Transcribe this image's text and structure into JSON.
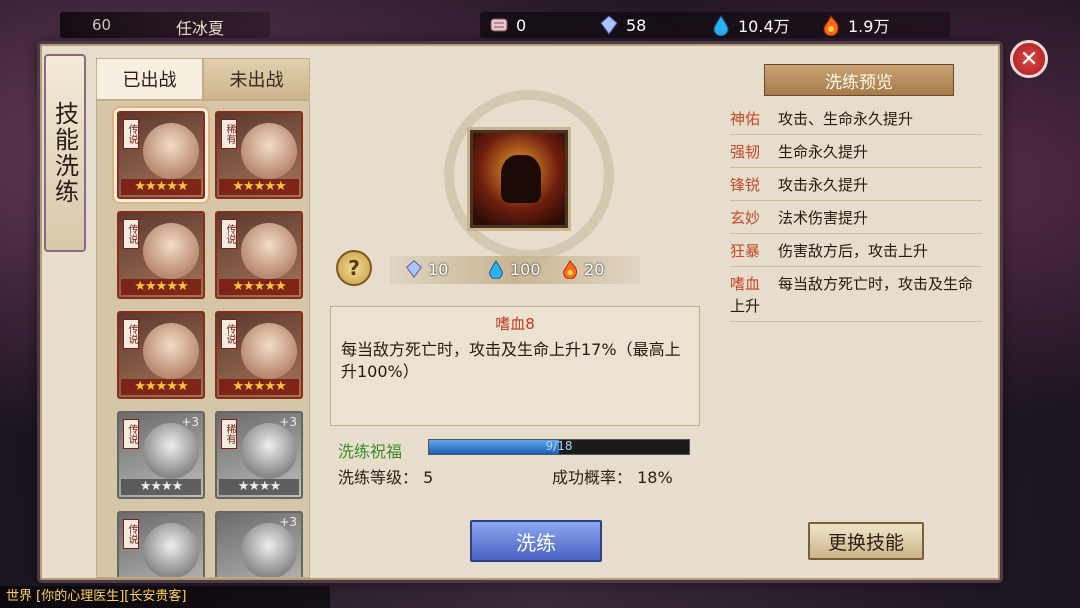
{
  "player": {
    "level": "60",
    "name": "任冰夏"
  },
  "resources": [
    {
      "icon": "scroll-icon",
      "value": "0"
    },
    {
      "icon": "crystal-icon",
      "value": "58"
    },
    {
      "icon": "water-drop-icon",
      "value": "10.4万"
    },
    {
      "icon": "flame-icon",
      "value": "1.9万"
    }
  ],
  "side_title": "技能洗练",
  "tabs": [
    {
      "label": "已出战"
    },
    {
      "label": "未出战"
    }
  ],
  "heroes": [
    {
      "tag": "传说",
      "stars": "★★★★★",
      "selected": true,
      "gray": false
    },
    {
      "tag": "稀有",
      "stars": "★★★★★",
      "selected": false,
      "gray": false
    },
    {
      "tag": "传说",
      "stars": "★★★★★",
      "selected": false,
      "gray": false
    },
    {
      "tag": "传说",
      "stars": "★★★★★",
      "selected": false,
      "gray": false
    },
    {
      "tag": "传说",
      "stars": "★★★★★",
      "selected": false,
      "gray": false
    },
    {
      "tag": "传说",
      "stars": "★★★★★",
      "selected": false,
      "gray": false
    },
    {
      "tag": "传说",
      "stars": "★★★★",
      "plus": "+3",
      "gray": true
    },
    {
      "tag": "稀有",
      "stars": "★★★★",
      "plus": "+3",
      "gray": true
    },
    {
      "tag": "传说",
      "stars": "★★★★",
      "gray": true
    },
    {
      "tag": "",
      "stars": "★★★★",
      "plus": "+3",
      "gray": true
    }
  ],
  "costs": [
    {
      "icon": "crystal-icon",
      "value": "10"
    },
    {
      "icon": "water-drop-icon",
      "value": "100"
    },
    {
      "icon": "flame-icon",
      "value": "20"
    }
  ],
  "help_label": "?",
  "skill": {
    "name": "嗜血8",
    "description": "每当敌方死亡时，攻击及生命上升17%（最高上升100%）"
  },
  "progress": {
    "label": "洗练祝福",
    "current": 9,
    "max": 18,
    "text": "9/18"
  },
  "level_text": "洗练等级：  5",
  "chance_text": "成功概率：  18%",
  "buttons": {
    "refine": "洗练",
    "change_skill": "更换技能"
  },
  "preview": {
    "title": "洗练预览",
    "items": [
      {
        "name": "神佑",
        "effect": "攻击、生命永久提升"
      },
      {
        "name": "强韧",
        "effect": "生命永久提升"
      },
      {
        "name": "锋锐",
        "effect": "攻击永久提升"
      },
      {
        "name": "玄妙",
        "effect": "法术伤害提升"
      },
      {
        "name": "狂暴",
        "effect": "伤害敌方后，攻击上升"
      },
      {
        "name": "嗜血",
        "effect": "每当敌方死亡时，攻击及生命上升"
      }
    ]
  },
  "close_label": "✕",
  "chat_text": "世界 [你的心理医生][长安贵客]"
}
